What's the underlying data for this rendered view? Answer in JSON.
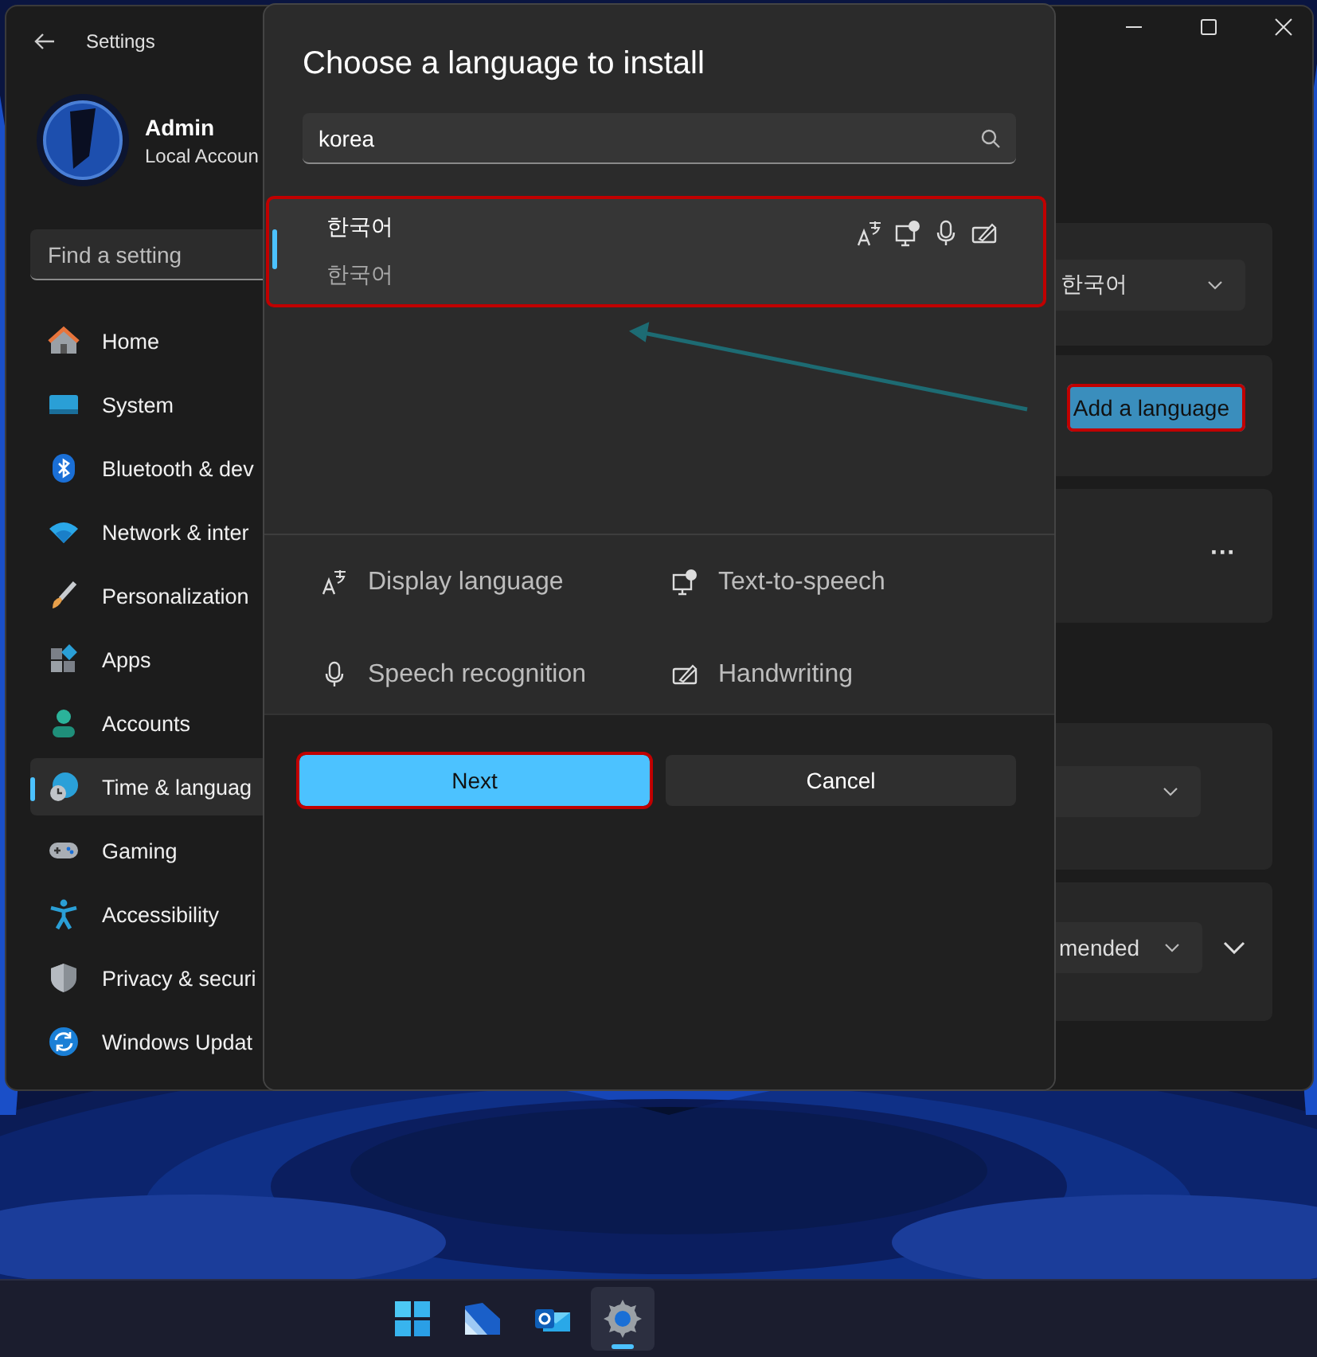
{
  "window": {
    "title": "Settings"
  },
  "profile": {
    "name": "Admin",
    "account": "Local Accoun"
  },
  "search": {
    "placeholder": "Find a setting"
  },
  "nav": [
    {
      "kind": "home",
      "label": "Home",
      "selected": false
    },
    {
      "kind": "system",
      "label": "System",
      "selected": false
    },
    {
      "kind": "bluetooth",
      "label": "Bluetooth & dev",
      "selected": false
    },
    {
      "kind": "network",
      "label": "Network & inter",
      "selected": false
    },
    {
      "kind": "personalization",
      "label": "Personalization",
      "selected": false
    },
    {
      "kind": "apps",
      "label": "Apps",
      "selected": false
    },
    {
      "kind": "accounts",
      "label": "Accounts",
      "selected": false
    },
    {
      "kind": "time",
      "label": "Time & languag",
      "selected": true
    },
    {
      "kind": "gaming",
      "label": "Gaming",
      "selected": false
    },
    {
      "kind": "accessibility",
      "label": "Accessibility",
      "selected": false
    },
    {
      "kind": "privacy",
      "label": "Privacy & securi",
      "selected": false
    },
    {
      "kind": "update",
      "label": "Windows Updat",
      "selected": false
    }
  ],
  "cards": [
    {
      "kind": "dropdown",
      "value": "한국어"
    },
    {
      "kind": "button",
      "label": "Add a language",
      "highlighted": true
    },
    {
      "kind": "more",
      "label": "···"
    },
    {
      "kind": "dropdown"
    },
    {
      "kind": "dropdown",
      "value": "mended",
      "expand": true
    }
  ],
  "dialog": {
    "title": "Choose a language to install",
    "search": {
      "value": "korea"
    },
    "results": [
      {
        "name": "한국어",
        "native": "한국어",
        "selected": true,
        "highlighted": true,
        "features": [
          {
            "kind": "display"
          },
          {
            "kind": "tts"
          },
          {
            "kind": "speech"
          },
          {
            "kind": "handwriting"
          }
        ]
      }
    ],
    "legend": [
      {
        "kind": "display",
        "label": "Display language"
      },
      {
        "kind": "tts",
        "label": "Text-to-speech"
      },
      {
        "kind": "speech",
        "label": "Speech recognition"
      },
      {
        "kind": "handwriting",
        "label": "Handwriting"
      }
    ],
    "buttons": [
      {
        "kind": "primary",
        "label": "Next",
        "highlighted": true
      },
      {
        "kind": "secondary",
        "label": "Cancel",
        "highlighted": false
      }
    ]
  },
  "callout_arrow": {
    "color": "#1d6b73"
  },
  "taskbar": {
    "apps": [
      {
        "kind": "start",
        "active": false
      },
      {
        "kind": "files",
        "active": false
      },
      {
        "kind": "mail",
        "active": false
      },
      {
        "kind": "settings",
        "active": true
      }
    ]
  }
}
